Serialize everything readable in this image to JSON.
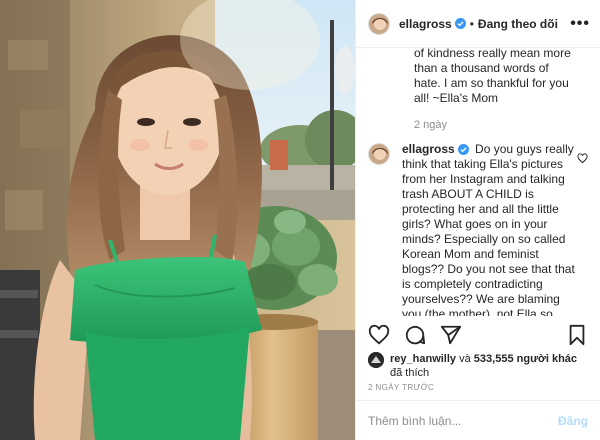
{
  "post": {
    "username": "ellagross",
    "follow_label": "Đang theo dõi",
    "more_label": "•••"
  },
  "comments": {
    "previous_text": "of kindness really mean more than a thousand words of hate. I am so thankful for you all! ~Ella's Mom",
    "previous_time": "2 ngày",
    "current": {
      "username": "ellagross",
      "text": "Do you guys really think that taking Ella's pictures from her Instagram and talking trash ABOUT A CHILD is protecting her and all the little girls? What goes on in your minds? Especially on so called Korean Mom and feminist blogs?? Do you not see that that is completely contradicting yourselves?? We are blaming you (the mother), not Ella so don't be naive comments justify talking trash about a girl and her family rather than actually fighting"
    }
  },
  "likes": {
    "liker": "rey_hanwilly",
    "connector": "và",
    "count": "533,555",
    "others_label": "người khác",
    "suffix": "đã thích"
  },
  "timestamp": "2 NGÀY TRƯỚC",
  "comment_box": {
    "placeholder": "Thêm bình luận...",
    "post_label": "Đăng"
  },
  "colors": {
    "verified_blue": "#3897f0",
    "dress_green": "#2fb56b",
    "post_disabled": "#b3dbff"
  },
  "icons": [
    "verified-badge-icon",
    "more-options-icon",
    "heart-icon",
    "comment-icon",
    "share-icon",
    "bookmark-icon"
  ]
}
